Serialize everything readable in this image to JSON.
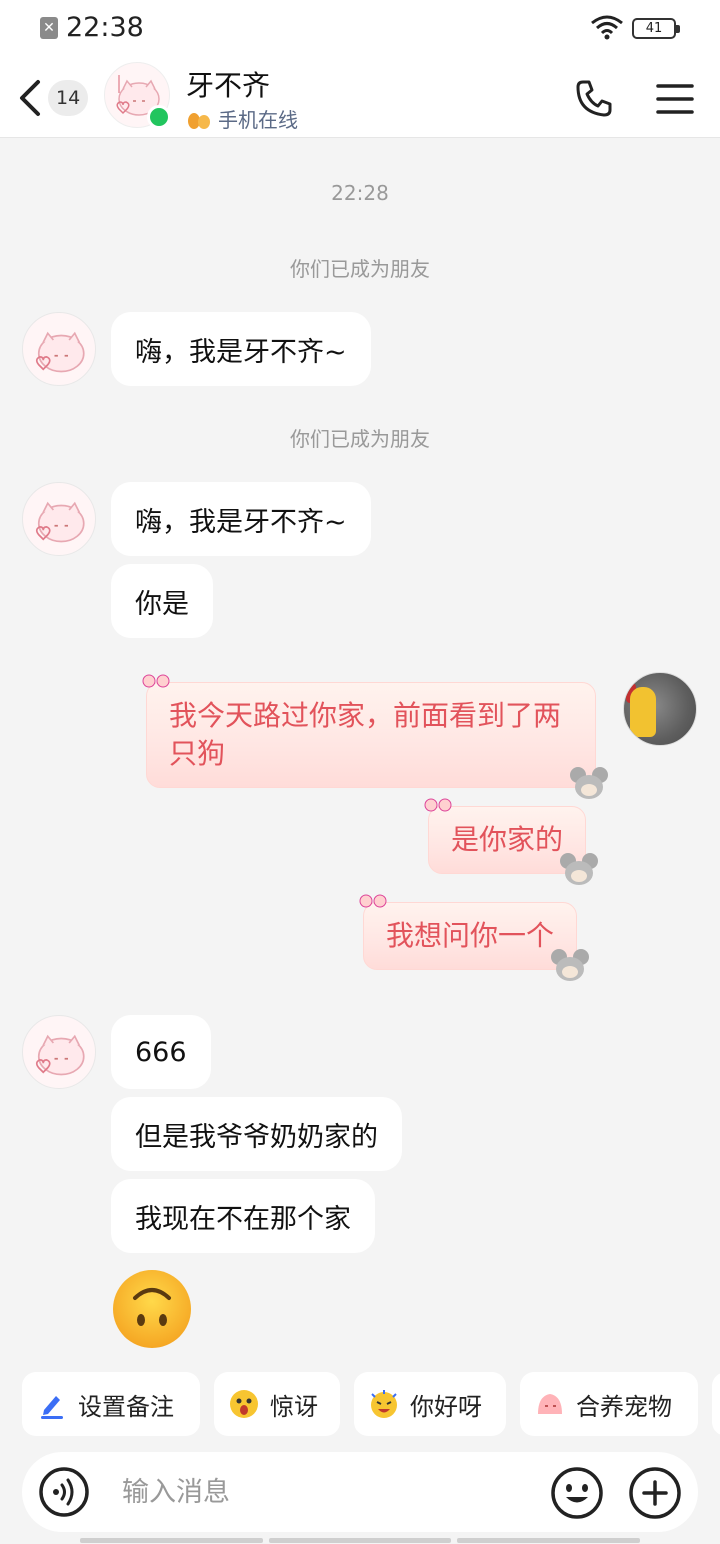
{
  "status_bar": {
    "time": "22:38",
    "battery": "41"
  },
  "header": {
    "back_count": "14",
    "contact_name": "牙不齐",
    "status_text": "手机在线"
  },
  "messages": {
    "time_divider": "22:28",
    "system_1": "你们已成为朋友",
    "in_1": "嗨，我是牙不齐~",
    "system_2": "你们已成为朋友",
    "in_2": "嗨，我是牙不齐~",
    "in_3": "你是",
    "out_1": "我今天路过你家，前面看到了两只狗",
    "out_2": "是你家的",
    "out_3": "我想问你一个",
    "in_4": "666",
    "in_5": "但是我爷爷奶奶家的",
    "in_6": "我现在不在那个家"
  },
  "quick_chips": [
    {
      "label": "设置备注",
      "icon": "pencil-icon"
    },
    {
      "label": "惊讶",
      "icon": "surprised-emoji-icon"
    },
    {
      "label": "你好呀",
      "icon": "hello-emoji-icon"
    },
    {
      "label": "合养宠物",
      "icon": "pet-icon"
    }
  ],
  "input": {
    "placeholder": "输入消息"
  },
  "colors": {
    "online": "#22c55e",
    "sent_text": "#e2535b",
    "sent_bg": "#ffe6e3",
    "chip_accent": "#3b6ef5"
  }
}
